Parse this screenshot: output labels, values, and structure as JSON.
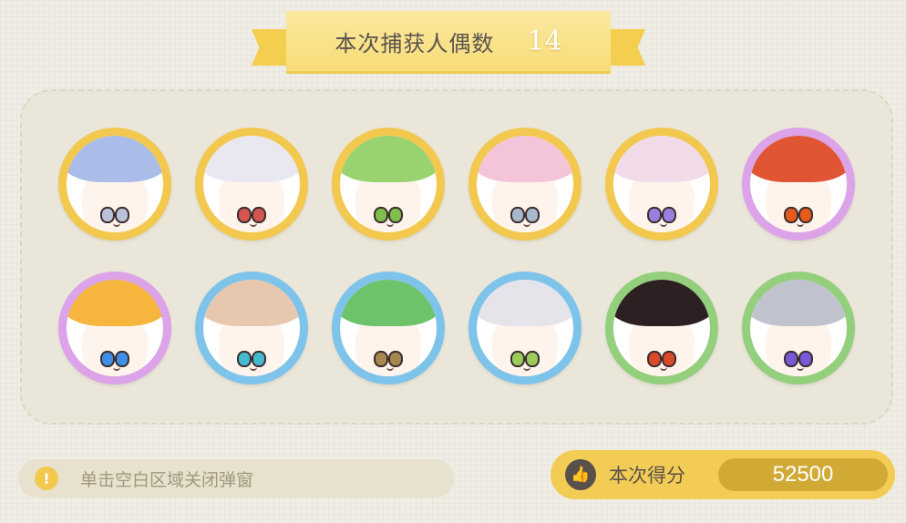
{
  "header": {
    "title": "本次捕获人偶数",
    "count": "14"
  },
  "avatars": [
    {
      "frame": "gold",
      "hair": "#a9bde8",
      "eye": "#b8c2d8"
    },
    {
      "frame": "gold",
      "hair": "#e9e8f1",
      "eye": "#d2564f"
    },
    {
      "frame": "gold",
      "hair": "#98d36f",
      "eye": "#7fbe4b"
    },
    {
      "frame": "gold",
      "hair": "#f4c4d9",
      "eye": "#a8b8cc"
    },
    {
      "frame": "gold",
      "hair": "#f1dbe8",
      "eye": "#9b7ee0"
    },
    {
      "frame": "purple",
      "hair": "#e05634",
      "eye": "#e65a1e"
    },
    {
      "frame": "purple",
      "hair": "#f6b53c",
      "eye": "#3f8fe6"
    },
    {
      "frame": "blue",
      "hair": "#e7c7ae",
      "eye": "#45b9cf"
    },
    {
      "frame": "blue",
      "hair": "#6cc36a",
      "eye": "#a6884f"
    },
    {
      "frame": "blue",
      "hair": "#e4e4ea",
      "eye": "#9acb5b"
    },
    {
      "frame": "green",
      "hair": "#2c2023",
      "eye": "#d84a2a"
    },
    {
      "frame": "green",
      "hair": "#c0c3ce",
      "eye": "#7c57d6"
    }
  ],
  "hint": {
    "icon": "exclamation-icon",
    "text": "单击空白区域关闭弹窗"
  },
  "score": {
    "icon": "thumbs-up-icon",
    "label": "本次得分",
    "value": "52500"
  },
  "colors": {
    "gold": "#f2c84f",
    "purple": "#dca3e8",
    "blue": "#7ec3ea",
    "green": "#93cf7c"
  }
}
